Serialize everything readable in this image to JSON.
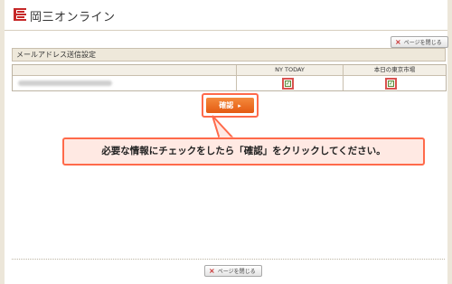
{
  "header": {
    "brand": "岡三オンライン"
  },
  "close_button": {
    "label": "ページを閉じる",
    "mark": "×"
  },
  "section": {
    "title": "メールアドレス送信設定"
  },
  "table": {
    "columns": [
      "NY TODAY",
      "本日の東京市場"
    ],
    "rows": [
      {
        "ny_today_checked": true,
        "tokyo_checked": true
      }
    ]
  },
  "confirm": {
    "label": "確認"
  },
  "callout": {
    "text": "必要な情報にチェックをしたら「確認」をクリックしてください。"
  },
  "colors": {
    "accent": "#e45a12",
    "highlight": "#ff6a4a",
    "logo": "#c62828"
  }
}
